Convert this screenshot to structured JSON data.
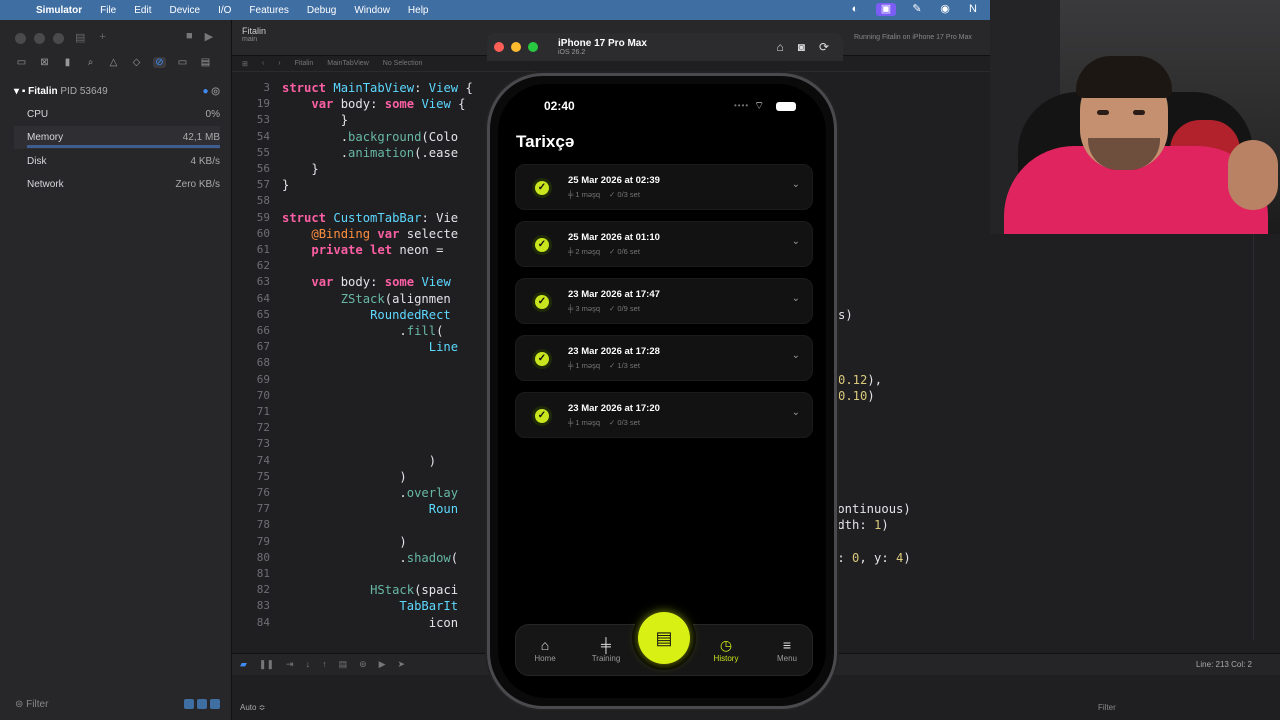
{
  "menubar": {
    "app": "Simulator",
    "items": [
      "File",
      "Edit",
      "Device",
      "I/O",
      "Features",
      "Debug",
      "Window",
      "Help"
    ]
  },
  "xcode": {
    "scheme_name": "Fitalin",
    "scheme_branch": "main",
    "breadcrumb": [
      "Fitalin",
      "MainTabView",
      "No Selection"
    ],
    "running_status": "Running Fitalin on iPhone 17 Pro Max",
    "process": {
      "name": "Fitalin",
      "pid": "PID 53649",
      "gauges": [
        {
          "label": "CPU",
          "value": "0%"
        },
        {
          "label": "Memory",
          "value": "42,1 MB"
        },
        {
          "label": "Disk",
          "value": "4 KB/s"
        },
        {
          "label": "Network",
          "value": "Zero KB/s"
        }
      ]
    },
    "filter_placeholder": "Filter",
    "debug_filter_placeholder": "Filter",
    "auto_label": "Auto ≎",
    "cursor_position": "Line: 213  Col: 2",
    "code_lines": [
      {
        "n": "3",
        "parts": [
          [
            "kw",
            "struct "
          ],
          [
            "ty",
            "MainTabView"
          ],
          [
            "",
            ": "
          ],
          [
            "ty",
            "View"
          ],
          [
            "",
            " {"
          ]
        ]
      },
      {
        "n": "19",
        "parts": [
          [
            "",
            "    "
          ],
          [
            "kw",
            "var "
          ],
          [
            "",
            "body: "
          ],
          [
            "kw",
            "some "
          ],
          [
            "ty",
            "View"
          ],
          [
            "",
            " {"
          ]
        ]
      },
      {
        "n": "53",
        "parts": [
          [
            "",
            "        }"
          ]
        ]
      },
      {
        "n": "54",
        "parts": [
          [
            "",
            "        ."
          ],
          [
            "fn",
            "background"
          ],
          [
            "",
            "(Colo"
          ]
        ]
      },
      {
        "n": "55",
        "parts": [
          [
            "",
            "        ."
          ],
          [
            "fn",
            "animation"
          ],
          [
            "",
            "(.ease"
          ]
        ]
      },
      {
        "n": "56",
        "parts": [
          [
            "",
            "    }"
          ]
        ]
      },
      {
        "n": "57",
        "parts": [
          [
            "",
            "}"
          ]
        ]
      },
      {
        "n": "58",
        "parts": [
          [
            "",
            ""
          ]
        ]
      },
      {
        "n": "59",
        "parts": [
          [
            "kw",
            "struct "
          ],
          [
            "ty",
            "CustomTabBar"
          ],
          [
            "",
            ": Vie"
          ]
        ]
      },
      {
        "n": "60",
        "parts": [
          [
            "",
            "    "
          ],
          [
            "at",
            "@Binding "
          ],
          [
            "kw",
            "var "
          ],
          [
            "",
            "selecte"
          ]
        ]
      },
      {
        "n": "61",
        "parts": [
          [
            "",
            "    "
          ],
          [
            "kw",
            "private let "
          ],
          [
            "",
            "neon = "
          ]
        ]
      },
      {
        "n": "62",
        "parts": [
          [
            "",
            ""
          ]
        ]
      },
      {
        "n": "63",
        "parts": [
          [
            "",
            "    "
          ],
          [
            "kw",
            "var "
          ],
          [
            "",
            "body: "
          ],
          [
            "kw",
            "some "
          ],
          [
            "ty",
            "View"
          ]
        ]
      },
      {
        "n": "64",
        "parts": [
          [
            "",
            "        "
          ],
          [
            "fn",
            "ZStack"
          ],
          [
            "",
            "(alignmen"
          ]
        ]
      },
      {
        "n": "65",
        "parts": [
          [
            "",
            "            "
          ],
          [
            "ty",
            "RoundedRect"
          ]
        ]
      },
      {
        "n": "66",
        "parts": [
          [
            "",
            "                ."
          ],
          [
            "fn",
            "fill"
          ],
          [
            "",
            "("
          ]
        ]
      },
      {
        "n": "67",
        "parts": [
          [
            "",
            "                    "
          ],
          [
            "ty",
            "Line"
          ]
        ]
      },
      {
        "n": "68",
        "parts": [
          [
            "",
            ""
          ]
        ]
      },
      {
        "n": "69",
        "parts": [
          [
            "",
            ""
          ]
        ]
      },
      {
        "n": "70",
        "parts": [
          [
            "",
            ""
          ]
        ]
      },
      {
        "n": "71",
        "parts": [
          [
            "",
            ""
          ]
        ]
      },
      {
        "n": "72",
        "parts": [
          [
            "",
            ""
          ]
        ]
      },
      {
        "n": "73",
        "parts": [
          [
            "",
            ""
          ]
        ]
      },
      {
        "n": "74",
        "parts": [
          [
            "",
            "                    )"
          ]
        ]
      },
      {
        "n": "75",
        "parts": [
          [
            "",
            "                )"
          ]
        ]
      },
      {
        "n": "76",
        "parts": [
          [
            "",
            "                ."
          ],
          [
            "fn",
            "overlay"
          ]
        ]
      },
      {
        "n": "77",
        "parts": [
          [
            "",
            "                    "
          ],
          [
            "ty",
            "Roun"
          ]
        ]
      },
      {
        "n": "78",
        "parts": [
          [
            "",
            ""
          ]
        ]
      },
      {
        "n": "79",
        "parts": [
          [
            "",
            "                )"
          ]
        ]
      },
      {
        "n": "80",
        "parts": [
          [
            "",
            "                ."
          ],
          [
            "fn",
            "shadow"
          ],
          [
            "",
            "("
          ]
        ]
      },
      {
        "n": "81",
        "parts": [
          [
            "",
            ""
          ]
        ]
      },
      {
        "n": "82",
        "parts": [
          [
            "",
            "            "
          ],
          [
            "fn",
            "HStack"
          ],
          [
            "",
            "(spaci"
          ]
        ]
      },
      {
        "n": "83",
        "parts": [
          [
            "",
            "                "
          ],
          [
            "ty",
            "TabBarIt"
          ]
        ]
      },
      {
        "n": "84",
        "parts": [
          [
            "",
            "                    icon"
          ]
        ]
      }
    ],
    "right_fragments": [
      {
        "line": "65",
        "parts": [
          [
            "",
            "s)"
          ]
        ]
      },
      {
        "line": "69",
        "parts": [
          [
            "nm",
            "0.12"
          ],
          [
            "",
            "),"
          ]
        ]
      },
      {
        "line": "70",
        "parts": [
          [
            "nm",
            "0.10"
          ],
          [
            "",
            ")"
          ]
        ]
      },
      {
        "line": "77",
        "parts": [
          [
            "",
            "continuous)"
          ]
        ]
      },
      {
        "line": "78",
        "parts": [
          [
            "",
            "idth: "
          ],
          [
            "nm",
            "1"
          ],
          [
            "",
            ")"
          ]
        ]
      },
      {
        "line": "80",
        "parts": [
          [
            "",
            "x: "
          ],
          [
            "nm",
            "0"
          ],
          [
            "",
            ", y: "
          ],
          [
            "nm",
            "4"
          ],
          [
            "",
            ")"
          ]
        ]
      }
    ]
  },
  "simulator": {
    "device": "iPhone 17 Pro Max",
    "os": "iOS 26.2"
  },
  "app": {
    "time": "02:40",
    "page_title": "Tarixçə",
    "history": [
      {
        "date": "25 Mar 2026 at 02:39",
        "workouts": "1 məşq",
        "sets": "0/3 set"
      },
      {
        "date": "25 Mar 2026 at 01:10",
        "workouts": "2 məşq",
        "sets": "0/6 set"
      },
      {
        "date": "23 Mar 2026 at 17:47",
        "workouts": "3 məşq",
        "sets": "0/9 set"
      },
      {
        "date": "23 Mar 2026 at 17:28",
        "workouts": "1 məşq",
        "sets": "1/3 set"
      },
      {
        "date": "23 Mar 2026 at 17:20",
        "workouts": "1 məşq",
        "sets": "0/3 set"
      }
    ],
    "tabs": [
      {
        "label": "Home",
        "icon": "house-icon"
      },
      {
        "label": "Training",
        "icon": "dumbbell-icon"
      },
      {
        "label": "History",
        "icon": "clock-history-icon",
        "active": true
      },
      {
        "label": "Menu",
        "icon": "menu-lines-icon"
      }
    ],
    "accent_color": "#d8f013"
  }
}
